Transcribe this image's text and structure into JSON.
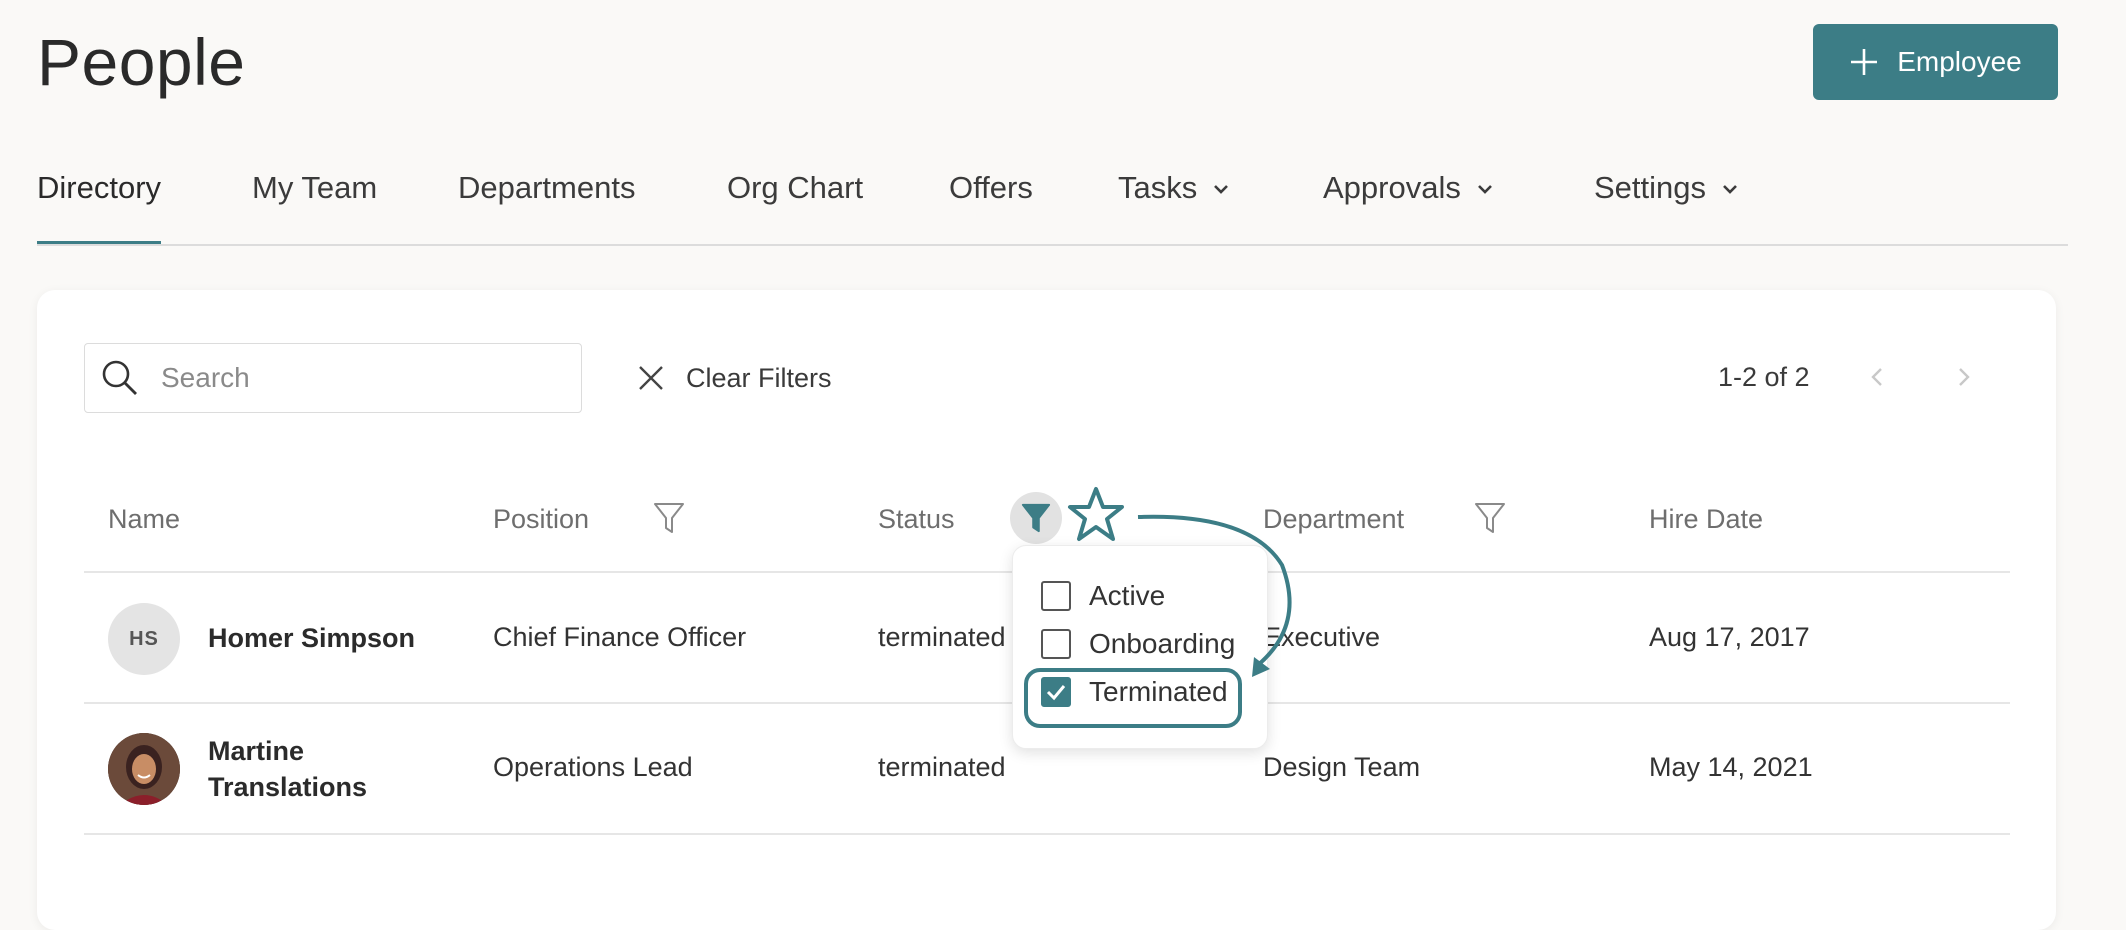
{
  "header": {
    "title": "People",
    "add_button_label": "Employee"
  },
  "tabs": [
    {
      "label": "Directory"
    },
    {
      "label": "My Team"
    },
    {
      "label": "Departments"
    },
    {
      "label": "Org Chart"
    },
    {
      "label": "Offers"
    },
    {
      "label": "Tasks"
    },
    {
      "label": "Approvals"
    },
    {
      "label": "Settings"
    }
  ],
  "toolbar": {
    "search_placeholder": "Search",
    "clear_filters_label": "Clear Filters",
    "pagination": "1-2 of 2"
  },
  "table": {
    "columns": [
      "Name",
      "Position",
      "Status",
      "Department",
      "Hire Date"
    ],
    "rows": [
      {
        "initials": "HS",
        "name": "Homer Simpson",
        "position": "Chief Finance Officer",
        "status": "terminated",
        "department": "Executive",
        "hire_date": "Aug 17, 2017"
      },
      {
        "name_line1": "Martine",
        "name_line2": "Translations",
        "position": "Operations Lead",
        "status": "terminated",
        "department": "Design Team",
        "hire_date": "May 14, 2021"
      }
    ]
  },
  "status_filter": {
    "options": [
      {
        "label": "Active",
        "checked": false
      },
      {
        "label": "Onboarding",
        "checked": false
      },
      {
        "label": "Terminated",
        "checked": true
      }
    ]
  },
  "colors": {
    "accent": "#3c7d86"
  }
}
